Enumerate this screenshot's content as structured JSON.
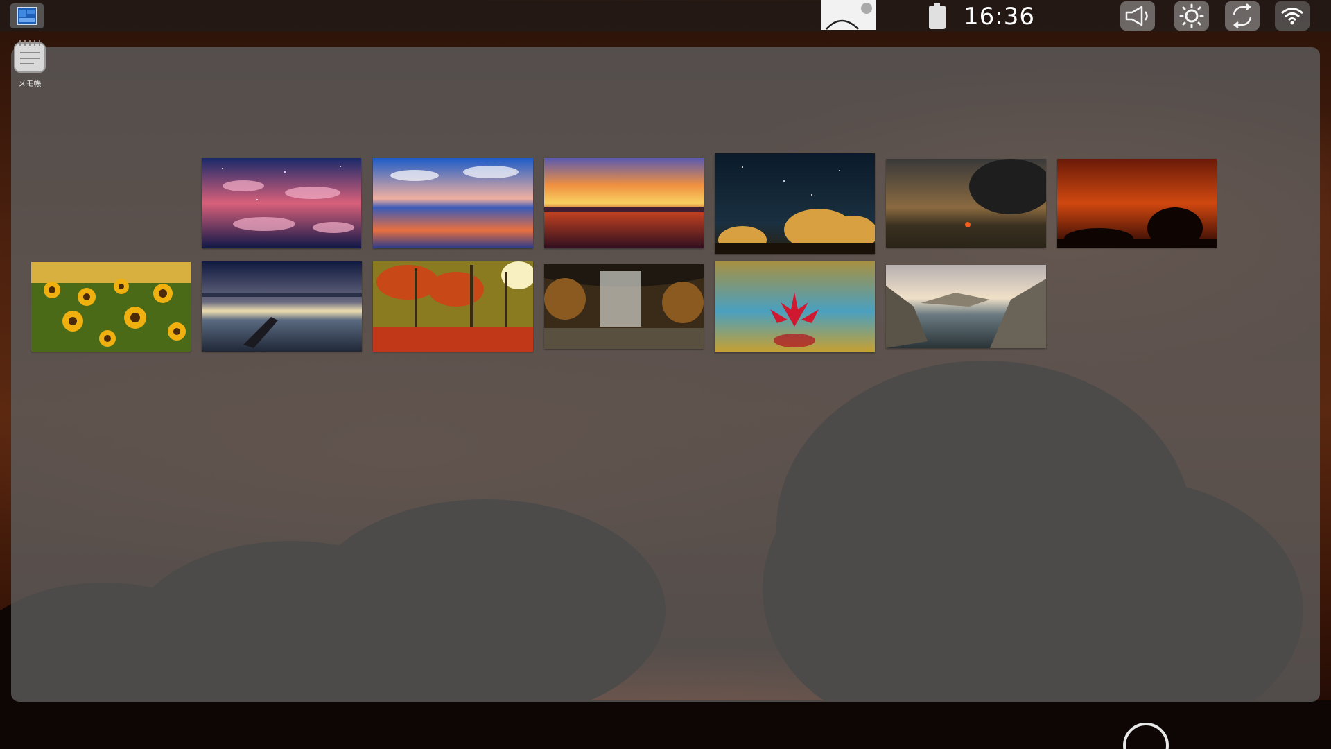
{
  "statusbar": {
    "time": "16:36",
    "icons": {
      "launcher": "launcher-icon",
      "notification": "notification-icon",
      "battery": "battery-icon",
      "volume": "volume-icon",
      "brightness": "brightness-icon",
      "rotate": "rotate-icon",
      "wifi": "wifi-icon"
    }
  },
  "desktop": {
    "shortcuts": [
      {
        "label": "メモ帳",
        "icon": "notepad-icon"
      }
    ]
  },
  "wallpaper_picker": {
    "thumbnails": [
      {
        "name": "starry-clouds-reflection"
      },
      {
        "name": "sunset-ocean-reflection"
      },
      {
        "name": "orange-sunset-lake"
      },
      {
        "name": "night-sky-autumn-trees"
      },
      {
        "name": "storm-cloud-sunset-city"
      },
      {
        "name": "red-sky-tree-silhouette"
      },
      {
        "name": "sunflower-field"
      },
      {
        "name": "boat-lake-dusk"
      },
      {
        "name": "autumn-forest-path"
      },
      {
        "name": "waterfall-cave"
      },
      {
        "name": "red-water-lily"
      },
      {
        "name": "mountain-lake-valley"
      }
    ]
  },
  "navbar": {
    "home_icon": "home-circle-icon"
  },
  "colors": {
    "panel": "#5f5f5f",
    "statusbar": "#1e1e1e",
    "sky_accent": "#e05a12"
  }
}
